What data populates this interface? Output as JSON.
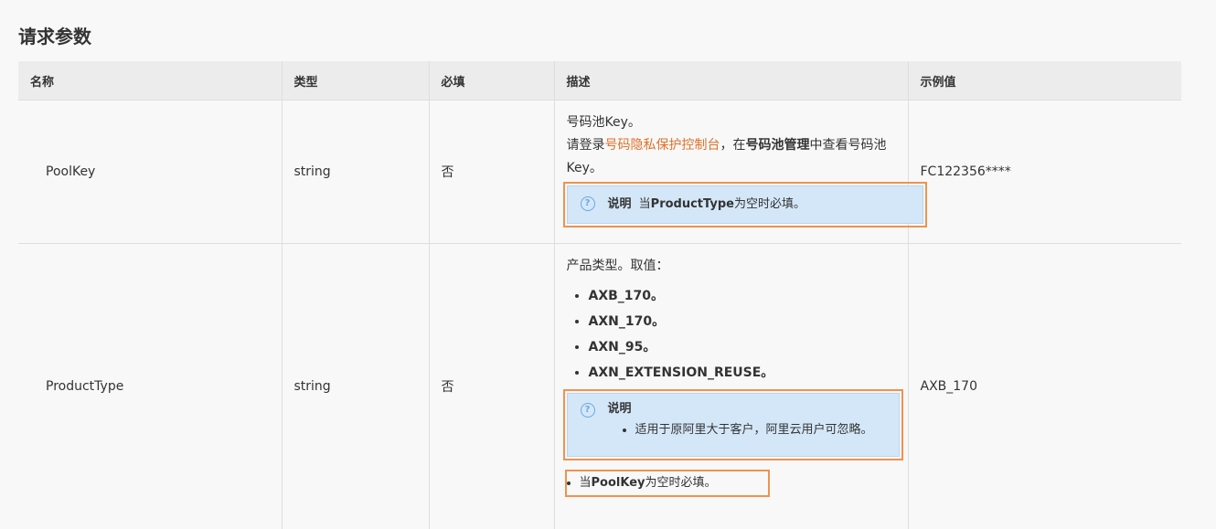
{
  "page_title": "请求参数",
  "columns": [
    "名称",
    "类型",
    "必填",
    "描述",
    "示例值"
  ],
  "rows": [
    {
      "name": "PoolKey",
      "type": "string",
      "required": "否",
      "desc_line1": "号码池Key。",
      "desc_pre": "请登录",
      "desc_link": "号码隐私保护控制台",
      "desc_mid": "，在",
      "desc_bold": "号码池管理",
      "desc_post": "中查看号码池Key。",
      "note_title": "说明",
      "note_pre": "当",
      "note_bold": "ProductType",
      "note_post": "为空时必填。",
      "example": "FC122356****"
    },
    {
      "name": "ProductType",
      "type": "string",
      "required": "否",
      "desc_line1": "产品类型。取值：",
      "values": [
        "AXB_170。",
        "AXN_170。",
        "AXN_95。",
        "AXN_EXTENSION_REUSE。"
      ],
      "note_title": "说明",
      "note_item": "适用于原阿里大于客户，阿里云用户可忽略。",
      "tail_pre": "当",
      "tail_bold": "PoolKey",
      "tail_post": "为空时必填。",
      "example": "AXB_170"
    }
  ],
  "icons": {
    "note": "question-circle-icon"
  },
  "colors": {
    "link": "#e0702a",
    "note_bg": "#d4e7f9",
    "highlight": "#f0924f"
  }
}
